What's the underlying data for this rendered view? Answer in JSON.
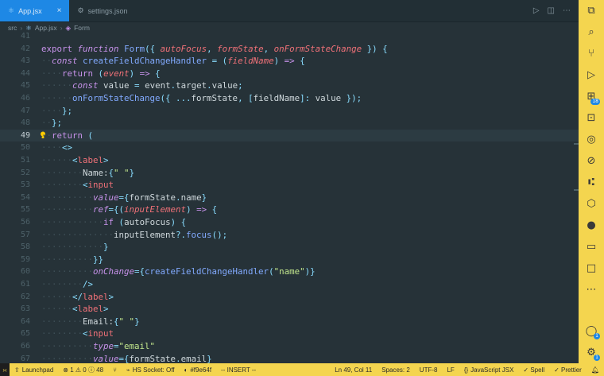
{
  "tabs": [
    {
      "label": "App.jsx",
      "active": true
    },
    {
      "label": "settings.json",
      "active": false
    }
  ],
  "breadcrumb": [
    "src",
    "App.jsx",
    "Form"
  ],
  "lines": [
    {
      "n": "41",
      "s": []
    },
    {
      "n": "42",
      "s": [
        [
          "kw",
          "export"
        ],
        [
          "v",
          " "
        ],
        [
          "k",
          "function"
        ],
        [
          "v",
          " "
        ],
        [
          "f",
          "Form"
        ],
        [
          "pn",
          "({ "
        ],
        [
          "p",
          "autoFocus"
        ],
        [
          "pn",
          ", "
        ],
        [
          "p",
          "formState"
        ],
        [
          "pn",
          ", "
        ],
        [
          "p",
          "onFormStateChange"
        ],
        [
          "pn",
          " }) {"
        ]
      ]
    },
    {
      "n": "43",
      "s": [
        [
          "ws",
          "··"
        ],
        [
          "k",
          "const"
        ],
        [
          "v",
          " "
        ],
        [
          "f",
          "createFieldChangeHandler"
        ],
        [
          "v",
          " "
        ],
        [
          "pn",
          "="
        ],
        [
          "v",
          " "
        ],
        [
          "pn",
          "("
        ],
        [
          "p",
          "fieldName"
        ],
        [
          "pn",
          ")"
        ],
        [
          "v",
          " "
        ],
        [
          "k",
          "=>"
        ],
        [
          "v",
          " "
        ],
        [
          "pn",
          "{"
        ]
      ]
    },
    {
      "n": "44",
      "s": [
        [
          "ws",
          "····"
        ],
        [
          "kw",
          "return"
        ],
        [
          "v",
          " "
        ],
        [
          "pn",
          "("
        ],
        [
          "p",
          "event"
        ],
        [
          "pn",
          ")"
        ],
        [
          "v",
          " "
        ],
        [
          "k",
          "=>"
        ],
        [
          "v",
          " "
        ],
        [
          "pn",
          "{"
        ]
      ]
    },
    {
      "n": "45",
      "s": [
        [
          "ws",
          "······"
        ],
        [
          "k",
          "const"
        ],
        [
          "v",
          " value "
        ],
        [
          "pn",
          "="
        ],
        [
          "v",
          " event"
        ],
        [
          "pn",
          "."
        ],
        [
          "v",
          "target"
        ],
        [
          "pn",
          "."
        ],
        [
          "v",
          "value"
        ],
        [
          "pn",
          ";"
        ]
      ]
    },
    {
      "n": "46",
      "s": [
        [
          "ws",
          "······"
        ],
        [
          "f",
          "onFormStateChange"
        ],
        [
          "pn",
          "({ ..."
        ],
        [
          "v",
          "formState"
        ],
        [
          "pn",
          ", ["
        ],
        [
          "v",
          "fieldName"
        ],
        [
          "pn",
          "]: "
        ],
        [
          "v",
          "value"
        ],
        [
          "pn",
          " });"
        ]
      ]
    },
    {
      "n": "47",
      "s": [
        [
          "ws",
          "····"
        ],
        [
          "pn",
          "};"
        ]
      ]
    },
    {
      "n": "48",
      "s": [
        [
          "ws",
          "··"
        ],
        [
          "pn",
          "};"
        ]
      ]
    },
    {
      "n": "49",
      "s": [
        [
          "ws",
          "··"
        ],
        [
          "kw",
          "return"
        ],
        [
          "v",
          " "
        ],
        [
          "pn",
          "("
        ]
      ],
      "cur": true
    },
    {
      "n": "50",
      "s": [
        [
          "ws",
          "····"
        ],
        [
          "pn",
          "<>"
        ]
      ]
    },
    {
      "n": "51",
      "s": [
        [
          "ws",
          "······"
        ],
        [
          "pn",
          "<"
        ],
        [
          "t",
          "label"
        ],
        [
          "pn",
          ">"
        ]
      ]
    },
    {
      "n": "52",
      "s": [
        [
          "ws",
          "········"
        ],
        [
          "v",
          "Name:"
        ],
        [
          "pn",
          "{"
        ],
        [
          "s",
          "\" \""
        ],
        [
          "pn",
          "}"
        ]
      ]
    },
    {
      "n": "53",
      "s": [
        [
          "ws",
          "········"
        ],
        [
          "pn",
          "<"
        ],
        [
          "t",
          "input"
        ]
      ]
    },
    {
      "n": "54",
      "s": [
        [
          "ws",
          "··········"
        ],
        [
          "a",
          "value"
        ],
        [
          "pn",
          "={"
        ],
        [
          "v",
          "formState"
        ],
        [
          "pn",
          "."
        ],
        [
          "v",
          "name"
        ],
        [
          "pn",
          "}"
        ]
      ]
    },
    {
      "n": "55",
      "s": [
        [
          "ws",
          "··········"
        ],
        [
          "a",
          "ref"
        ],
        [
          "pn",
          "={("
        ],
        [
          "p",
          "inputElement"
        ],
        [
          "pn",
          ")"
        ],
        [
          "v",
          " "
        ],
        [
          "k",
          "=>"
        ],
        [
          "v",
          " "
        ],
        [
          "pn",
          "{"
        ]
      ]
    },
    {
      "n": "56",
      "s": [
        [
          "ws",
          "············"
        ],
        [
          "kw",
          "if"
        ],
        [
          "v",
          " "
        ],
        [
          "pn",
          "("
        ],
        [
          "v",
          "autoFocus"
        ],
        [
          "pn",
          ")"
        ],
        [
          "v",
          " "
        ],
        [
          "pn",
          "{"
        ]
      ]
    },
    {
      "n": "57",
      "s": [
        [
          "ws",
          "··············"
        ],
        [
          "v",
          "inputElement"
        ],
        [
          "pn",
          "?."
        ],
        [
          "f",
          "focus"
        ],
        [
          "pn",
          "();"
        ]
      ]
    },
    {
      "n": "58",
      "s": [
        [
          "ws",
          "············"
        ],
        [
          "pn",
          "}"
        ]
      ]
    },
    {
      "n": "59",
      "s": [
        [
          "ws",
          "··········"
        ],
        [
          "pn",
          "}}"
        ]
      ]
    },
    {
      "n": "60",
      "s": [
        [
          "ws",
          "··········"
        ],
        [
          "a",
          "onChange"
        ],
        [
          "pn",
          "={"
        ],
        [
          "f",
          "createFieldChangeHandler"
        ],
        [
          "pn",
          "("
        ],
        [
          "s",
          "\"name\""
        ],
        [
          "pn",
          ")}"
        ]
      ]
    },
    {
      "n": "61",
      "s": [
        [
          "ws",
          "········"
        ],
        [
          "pn",
          "/>"
        ]
      ]
    },
    {
      "n": "62",
      "s": [
        [
          "ws",
          "······"
        ],
        [
          "pn",
          "</"
        ],
        [
          "t",
          "label"
        ],
        [
          "pn",
          ">"
        ]
      ]
    },
    {
      "n": "63",
      "s": [
        [
          "ws",
          "······"
        ],
        [
          "pn",
          "<"
        ],
        [
          "t",
          "label"
        ],
        [
          "pn",
          ">"
        ]
      ]
    },
    {
      "n": "64",
      "s": [
        [
          "ws",
          "········"
        ],
        [
          "v",
          "Email:"
        ],
        [
          "pn",
          "{"
        ],
        [
          "s",
          "\" \""
        ],
        [
          "pn",
          "}"
        ]
      ]
    },
    {
      "n": "65",
      "s": [
        [
          "ws",
          "········"
        ],
        [
          "pn",
          "<"
        ],
        [
          "t",
          "input"
        ]
      ]
    },
    {
      "n": "66",
      "s": [
        [
          "ws",
          "··········"
        ],
        [
          "a",
          "type"
        ],
        [
          "pn",
          "="
        ],
        [
          "s",
          "\"email\""
        ]
      ]
    },
    {
      "n": "67",
      "s": [
        [
          "ws",
          "··········"
        ],
        [
          "a",
          "value"
        ],
        [
          "pn",
          "={"
        ],
        [
          "v",
          "formState"
        ],
        [
          "pn",
          "."
        ],
        [
          "v",
          "email"
        ],
        [
          "pn",
          "}"
        ]
      ]
    }
  ],
  "activity": [
    {
      "name": "explorer-icon",
      "glyph": "⧉"
    },
    {
      "name": "search-icon",
      "glyph": "⌕"
    },
    {
      "name": "source-control-icon",
      "glyph": "⑂"
    },
    {
      "name": "run-debug-icon",
      "glyph": "▷"
    },
    {
      "name": "extensions-icon",
      "glyph": "⊞",
      "badge": "18"
    },
    {
      "name": "remote-explorer-icon",
      "glyph": "⊡"
    },
    {
      "name": "accounts-check-icon",
      "glyph": "◎"
    },
    {
      "name": "testing-icon",
      "glyph": "⊘"
    },
    {
      "name": "git-graph-icon",
      "glyph": "⑆"
    },
    {
      "name": "package-icon",
      "glyph": "⬡"
    },
    {
      "name": "github-icon",
      "glyph": "●"
    },
    {
      "name": "terminal-icon",
      "glyph": "▭"
    },
    {
      "name": "square-icon",
      "glyph": "□"
    },
    {
      "name": "more-icon",
      "glyph": "⋯"
    },
    {
      "name": "account-icon",
      "glyph": "◯",
      "badge": "1"
    },
    {
      "name": "settings-gear-icon",
      "glyph": "⚙",
      "badge": "1"
    }
  ],
  "status": {
    "launchpad": "Launchpad",
    "problems": "⊗ 1 ⚠ 0 ⓘ 48",
    "hs_socket": "HS Socket: Off",
    "commit": "#f9e64f",
    "mode": "-- INSERT --",
    "position": "Ln 49, Col 11",
    "spaces": "Spaces: 2",
    "encoding": "UTF-8",
    "eol": "LF",
    "language": "JavaScript JSX",
    "spell": "✓ Spell",
    "prettier": "✓ Prettier"
  },
  "colors": {
    "accent": "#1e88e5",
    "activity_bar": "#f4d54f",
    "editor_bg": "#263238"
  }
}
